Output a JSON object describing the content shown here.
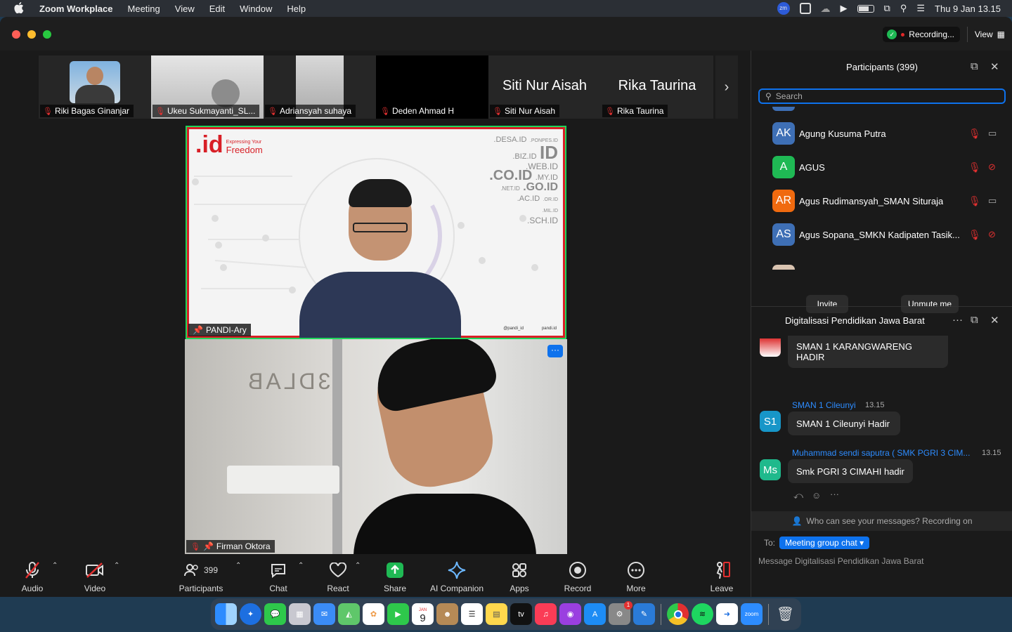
{
  "menubar": {
    "apple": "",
    "app": "Zoom Workplace",
    "menus": [
      "Meeting",
      "View",
      "Edit",
      "Window",
      "Help"
    ],
    "clock": "Thu 9 Jan  13.15"
  },
  "titlebar": {
    "recording": "Recording...",
    "view": "View"
  },
  "strip": [
    {
      "name": "Riki Bagas Ginanjar",
      "big": ""
    },
    {
      "name": "Ukeu Sukmayanti_SL...",
      "big": ""
    },
    {
      "name": "Adriansyah suhaya",
      "big": ""
    },
    {
      "name": "Deden Ahmad H",
      "big": ""
    },
    {
      "name": "Siti Nur Aisah",
      "big": "Siti Nur Aisah"
    },
    {
      "name": "Rika Taurina",
      "big": "Rika Taurina"
    }
  ],
  "videos": {
    "main1": "PANDI-Ary",
    "main2": "Firman Oktora",
    "slide_brand": ".id",
    "slide_tag1": "Expressing Your",
    "slide_tag2": "Freedom",
    "domains": [
      ".DESA.ID",
      ".PONPES.ID",
      ".BIZ.ID",
      "ID",
      ".WEB.ID",
      ".CO.ID",
      ".MY.ID",
      ".NET.ID",
      ".GO.ID",
      ".AC.ID",
      ".OR.ID",
      ".MIL.ID",
      ".SCH.ID"
    ],
    "slide_foot1": "@pandi_id",
    "slide_foot2": "pandi.id",
    "wall_text": "3DLAB"
  },
  "toolbar": {
    "audio": "Audio",
    "video": "Video",
    "participants": "Participants",
    "participants_count": "399",
    "chat": "Chat",
    "react": "React",
    "share": "Share",
    "ai": "AI Companion",
    "apps": "Apps",
    "record": "Record",
    "more": "More",
    "leave": "Leave"
  },
  "participants": {
    "title": "Participants (399)",
    "search_placeholder": "Search",
    "list": [
      {
        "initials": "AK",
        "name": "Agung Kusuma Putra",
        "color": "#3e6fb5",
        "cam_off": false
      },
      {
        "initials": "A",
        "name": "AGUS",
        "color": "#1fb954",
        "cam_off": true
      },
      {
        "initials": "AR",
        "name": "Agus Rudimansyah_SMAN Situraja",
        "color": "#f06a0f",
        "cam_off": false
      },
      {
        "initials": "AS",
        "name": "Agus Sopana_SMKN Kadipaten Tasik...",
        "color": "#3e6fb5",
        "cam_off": true
      }
    ],
    "invite": "Invite",
    "unmute": "Unmute me"
  },
  "chat": {
    "title": "Digitalisasi Pendidikan Jawa Barat",
    "messages": [
      {
        "sender": "",
        "time": "",
        "text": "SMAN 1 KARANGWARENG HADIR",
        "initials": ""
      },
      {
        "sender": "SMAN 1 Cileunyi",
        "time": "13.15",
        "text": "SMAN 1 Cileunyi Hadir",
        "initials": "S1"
      },
      {
        "sender": "Muhammad sendi saputra ( SMK PGRI 3 CIM...",
        "time": "13.15",
        "text": "Smk PGRI 3 CIMAHI hadir",
        "initials": "Ms"
      }
    ],
    "privacy": "Who can see your messages? Recording on",
    "to_label": "To:",
    "to_target": "Meeting group chat",
    "placeholder": "Message Digitalisasi Pendidikan Jawa Barat"
  },
  "dock": {
    "calendar_month": "JAN",
    "calendar_day": "9",
    "tv": "tv",
    "zoom": "zoom",
    "badge": "1"
  },
  "colors": {
    "accent": "#0e72ed",
    "active_speaker": "#1fd65c",
    "mute_red": "#e23030"
  }
}
